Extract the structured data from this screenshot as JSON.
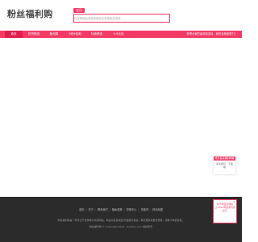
{
  "header": {
    "logo_text": "粉丝福利购",
    "search_tab": "宝贝",
    "search_placeholder": "在这里粘贴商品标题或名称搜索优惠券"
  },
  "nav": {
    "items": [
      "首页",
      "好货精选",
      "聚划算",
      "9块9包邮",
      "特卖精选",
      "9.9元包"
    ],
    "notice": "获得大家的喜欢和支持，我们会继续努力！"
  },
  "side_card": {
    "title": "成为皇冠福利网客",
    "text": "关注我们，不迷路"
  },
  "footer": {
    "links": [
      "首页",
      "关于",
      "联系我们",
      "隐私政策",
      "帮助中心",
      "关键词",
      "网站地图"
    ],
    "description": "粉丝福利购是一家专注于优惠券分享的网站，商品均来自淘宝/天猫官方渠道，每天更新海量优惠券，领券下单更省钱。",
    "copyright": "粉丝福利购 © Copyright 2019 · fensifuli.com 版权所有"
  },
  "float_box": {
    "text": "关于淘宝高佣接口-2019年最新可用接口",
    "close": "×"
  },
  "colors": {
    "accent": "#f33a66",
    "accent_dark": "#e01e4e",
    "footer_bg": "#2b2b2b"
  }
}
